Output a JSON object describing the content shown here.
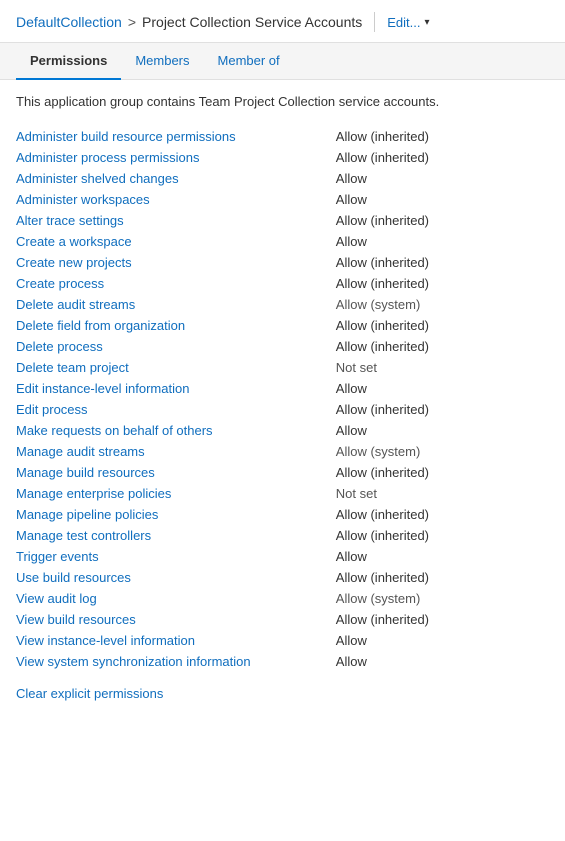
{
  "header": {
    "breadcrumb_link": "DefaultCollection",
    "breadcrumb_sep": ">",
    "breadcrumb_current": "Project Collection Service Accounts",
    "edit_label": "Edit...",
    "chevron": "▾"
  },
  "tabs": [
    {
      "label": "Permissions",
      "active": true
    },
    {
      "label": "Members",
      "active": false
    },
    {
      "label": "Member of",
      "active": false
    }
  ],
  "description": "This application group contains Team Project Collection service accounts.",
  "permissions": [
    {
      "name": "Administer build resource permissions",
      "value": "Allow (inherited)",
      "class": "allow-inherited"
    },
    {
      "name": "Administer process permissions",
      "value": "Allow (inherited)",
      "class": "allow-inherited"
    },
    {
      "name": "Administer shelved changes",
      "value": "Allow",
      "class": "allow"
    },
    {
      "name": "Administer workspaces",
      "value": "Allow",
      "class": "allow"
    },
    {
      "name": "Alter trace settings",
      "value": "Allow (inherited)",
      "class": "allow-inherited"
    },
    {
      "name": "Create a workspace",
      "value": "Allow",
      "class": "allow"
    },
    {
      "name": "Create new projects",
      "value": "Allow (inherited)",
      "class": "allow-inherited"
    },
    {
      "name": "Create process",
      "value": "Allow (inherited)",
      "class": "allow-inherited"
    },
    {
      "name": "Delete audit streams",
      "value": "Allow (system)",
      "class": "allow-system"
    },
    {
      "name": "Delete field from organization",
      "value": "Allow (inherited)",
      "class": "allow-inherited"
    },
    {
      "name": "Delete process",
      "value": "Allow (inherited)",
      "class": "allow-inherited"
    },
    {
      "name": "Delete team project",
      "value": "Not set",
      "class": "not-set"
    },
    {
      "name": "Edit instance-level information",
      "value": "Allow",
      "class": "allow"
    },
    {
      "name": "Edit process",
      "value": "Allow (inherited)",
      "class": "allow-inherited"
    },
    {
      "name": "Make requests on behalf of others",
      "value": "Allow",
      "class": "allow"
    },
    {
      "name": "Manage audit streams",
      "value": "Allow (system)",
      "class": "allow-system"
    },
    {
      "name": "Manage build resources",
      "value": "Allow (inherited)",
      "class": "allow-inherited"
    },
    {
      "name": "Manage enterprise policies",
      "value": "Not set",
      "class": "not-set"
    },
    {
      "name": "Manage pipeline policies",
      "value": "Allow (inherited)",
      "class": "allow-inherited"
    },
    {
      "name": "Manage test controllers",
      "value": "Allow (inherited)",
      "class": "allow-inherited"
    },
    {
      "name": "Trigger events",
      "value": "Allow",
      "class": "allow"
    },
    {
      "name": "Use build resources",
      "value": "Allow (inherited)",
      "class": "allow-inherited"
    },
    {
      "name": "View audit log",
      "value": "Allow (system)",
      "class": "allow-system"
    },
    {
      "name": "View build resources",
      "value": "Allow (inherited)",
      "class": "allow-inherited"
    },
    {
      "name": "View instance-level information",
      "value": "Allow",
      "class": "allow"
    },
    {
      "name": "View system synchronization information",
      "value": "Allow",
      "class": "allow"
    }
  ],
  "clear_link": "Clear explicit permissions"
}
